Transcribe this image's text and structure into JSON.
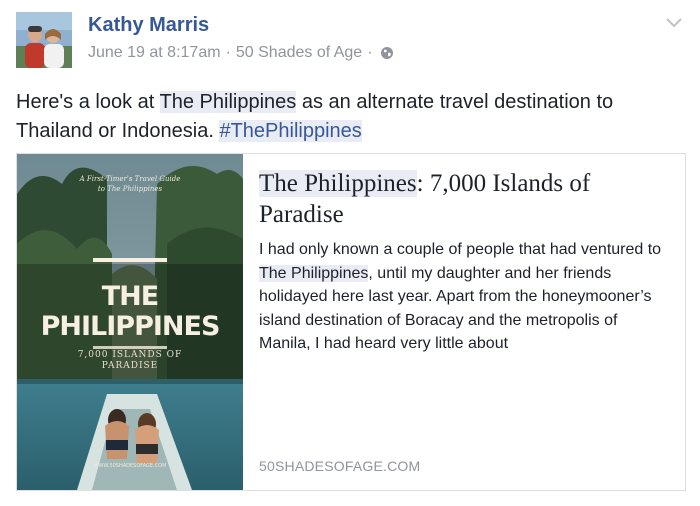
{
  "post": {
    "author": "Kathy Marris",
    "date": "June 19 at 8:17am",
    "page": "50 Shades of Age",
    "separator": "·",
    "text": {
      "before": "Here's a look at ",
      "link": "The Philippines",
      "middle": " as an alternate travel destination to Thailand or Indonesia. ",
      "hashtag": "#ThePhilippines"
    }
  },
  "card": {
    "title_link": "The Philippines",
    "title_rest": ": 7,000 Islands of Paradise",
    "desc_before": "I had only known a couple of people that had ventured to ",
    "desc_link": "The Philippines",
    "desc_after": ", until my daughter and her friends holidayed here last year. Apart from the honeymooner’s island destination of Boracay and the metropolis of Manila, I had heard very little about",
    "domain": "50SHADESOFAGE.COM",
    "cover": {
      "guide_line1": "A First-Timer's Travel Guide",
      "guide_line2": "to The Philippines",
      "title_line1": "THE",
      "title_line2": "PHILIPPINES",
      "sub_line1": "7,000 ISLANDS OF",
      "sub_line2": "PARADISE",
      "website": "WWW.50SHADESOFAGE.COM"
    }
  },
  "icons": {
    "globe": "globe-icon",
    "menu": "chevron-down-icon"
  },
  "colors": {
    "link": "#365899",
    "meta": "#90949c",
    "highlight": "#e9ecf5",
    "border": "#dddfe2"
  }
}
